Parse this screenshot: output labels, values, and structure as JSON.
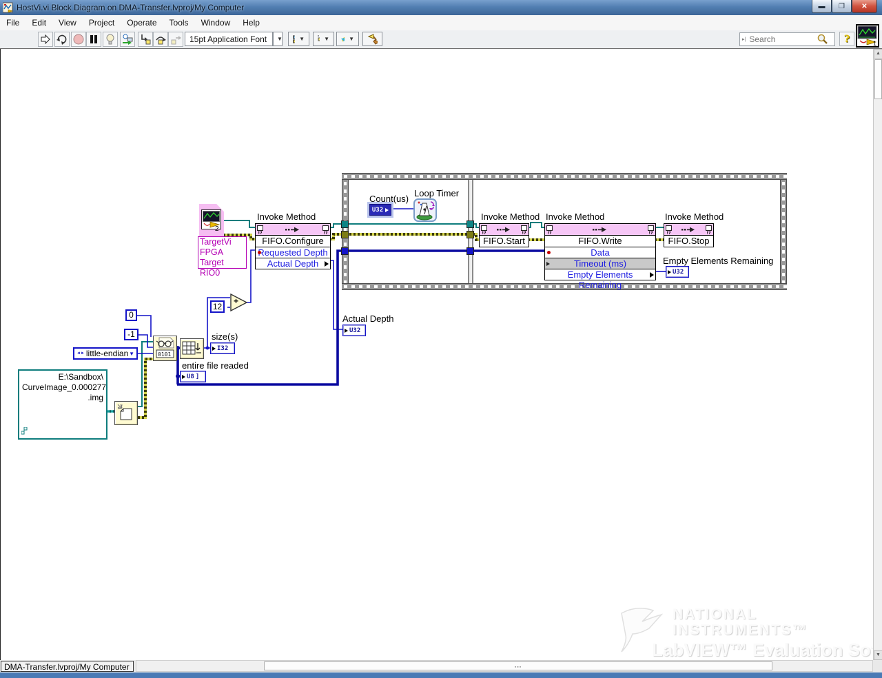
{
  "window": {
    "title": "HostVi.vi Block Diagram on DMA-Transfer.lvproj/My Computer"
  },
  "menu": {
    "items": [
      "File",
      "Edit",
      "View",
      "Project",
      "Operate",
      "Tools",
      "Window",
      "Help"
    ]
  },
  "toolbar": {
    "font_label": "15pt Application Font",
    "search_placeholder": "Search"
  },
  "status": {
    "context": "DMA-Transfer.lvproj/My Computer"
  },
  "wm": {
    "l1": "NATIONAL",
    "l2": "INSTRUMENTS™",
    "l3": "LabVIEW™ Evaluation Software"
  },
  "d": {
    "invoke_label": "Invoke Method",
    "target": {
      "l1": "TargetVi",
      "l2": "FPGA Target",
      "l3": "RIO0",
      "badge": "2"
    },
    "cfg": {
      "method": "FIFO.Configure",
      "p1": "Requested Depth",
      "p2": "Actual Depth"
    },
    "start": {
      "method": "FIFO.Start"
    },
    "write": {
      "method": "FIFO.Write",
      "p1": "Data",
      "p2": "Timeout (ms)",
      "p3": "Empty Elements Remaining"
    },
    "stop": {
      "method": "FIFO.Stop"
    },
    "loop": {
      "label": "Loop Timer",
      "count_label": "Count(us)"
    },
    "types": {
      "u32": "U32",
      "i32": "I32",
      "u8": "U8",
      "bracket": "]"
    },
    "labels": {
      "actual_depth": "Actual Depth",
      "empty_elements": "Empty Elements Remaining",
      "sizes": "size(s)",
      "entire_file": "entire file readed"
    },
    "consts": {
      "zero": "0",
      "minus_one": "-1",
      "twelve": "12",
      "endian": "little-endian",
      "plus": "+"
    },
    "path": {
      "l1": "E:\\Sandbox\\",
      "l2": "CurveImage_0.000277",
      "l3": ".img"
    },
    "colors": {
      "wire_teal": "#0e7d7d",
      "wire_blue": "#1414c8",
      "wire_array": "#0a0aa0",
      "error_yellow": "#d2d24a",
      "node_pink": "#f6c6f6",
      "magenta": "#b400b4"
    }
  }
}
